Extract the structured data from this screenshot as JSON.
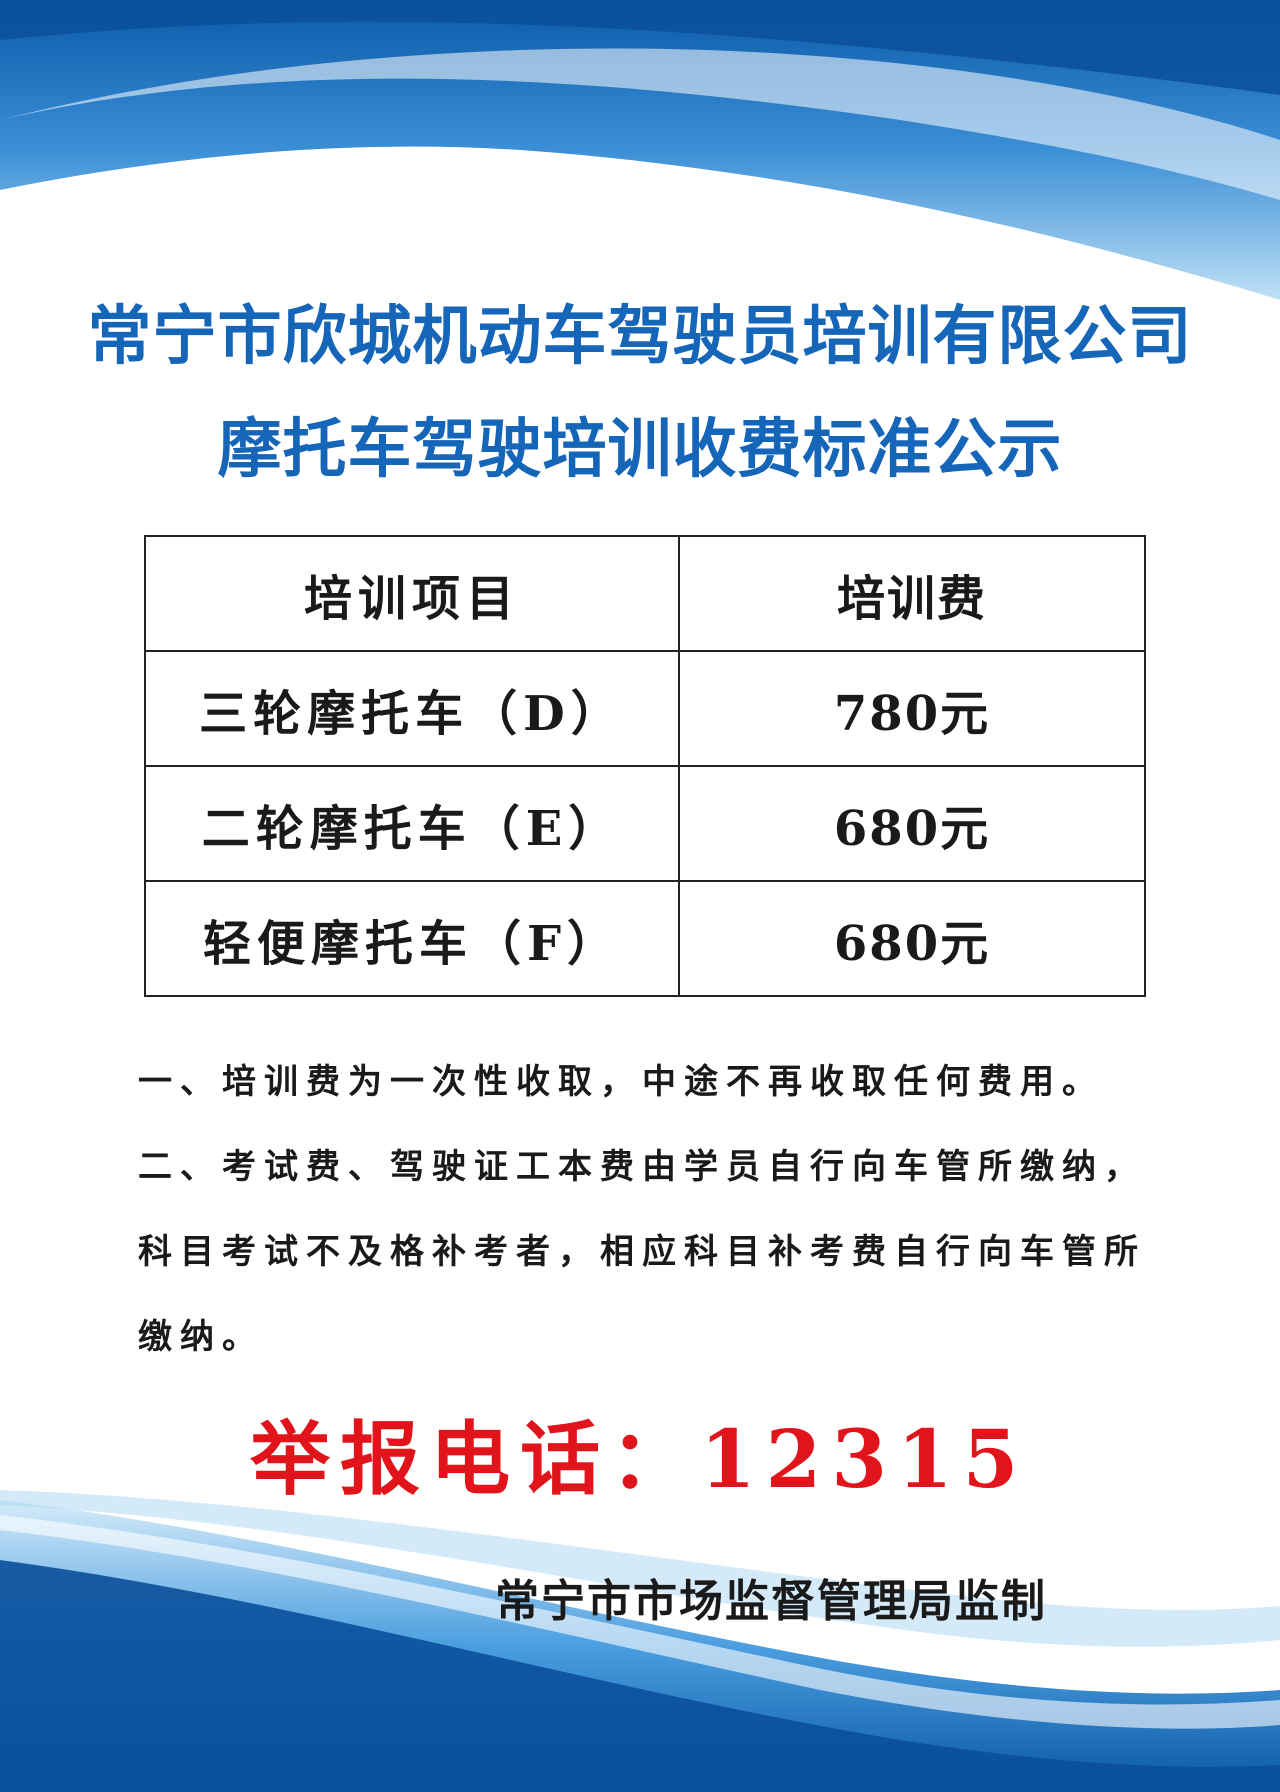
{
  "header": {
    "title_line1": "常宁市欣城机动车驾驶员培训有限公司",
    "title_line2": "摩托车驾驶培训收费标准公示"
  },
  "table": {
    "headers": [
      "培训项目",
      "培训费"
    ],
    "rows": [
      {
        "item": "三轮摩托车（D）",
        "fee": "780元"
      },
      {
        "item": "二轮摩托车（E）",
        "fee": "680元"
      },
      {
        "item": "轻便摩托车（F）",
        "fee": "680元"
      }
    ]
  },
  "notes": [
    "一、培训费为一次性收取，中途不再收取任何费用。",
    "二、考试费、驾驶证工本费由学员自行向车管所缴纳，科目考试不及格补考者，相应科目补考费自行向车管所缴纳。"
  ],
  "hotline": "举报电话：12315",
  "footer": "常宁市市场监督管理局监制",
  "colors": {
    "title": "#1565b8",
    "hotline": "#e0141a",
    "wave_dark": "#0d5fb0",
    "wave_light": "#6fb6e6"
  }
}
